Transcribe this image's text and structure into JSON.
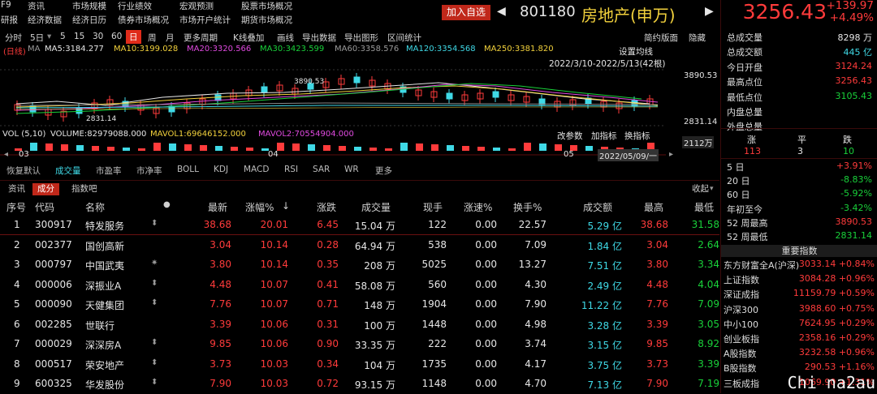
{
  "menu": [
    "F9",
    "资讯",
    "市场规模",
    "行业绩效",
    "宏观预测",
    "股票市场概况",
    "研报",
    "经济数据",
    "经济日历",
    "债券市场概况",
    "市场开户统计",
    "期货市场概况"
  ],
  "add_btn": "加入自选",
  "code": "801180",
  "name": "房地产(申万)",
  "price": "3256.43",
  "change": "+139.97",
  "change_pct": "+4.49%",
  "toolbar": [
    "分时",
    "5日",
    "5",
    "15",
    "30",
    "60",
    "日",
    "周",
    "月",
    "更多周期",
    "K线叠加",
    "画线",
    "导出数据",
    "导出图形",
    "区间统计",
    "简约版面",
    "隐藏"
  ],
  "ma_line": {
    "type": "(日线)",
    "ma": "MA",
    "ma5": "MA5:3184.277",
    "ma10": "MA10:3199.028",
    "ma20": "MA20:3320.566",
    "ma30": "MA30:3423.599",
    "ma60": "MA60:3358.576",
    "ma120": "MA120:3354.568",
    "ma250": "MA250:3381.820"
  },
  "chart": {
    "settings": "设置均线",
    "range": "2022/3/10-2022/5/13(42根)",
    "high_label": "3890.53",
    "low_label": "2831.14",
    "mid_label": "3890.53",
    "cur_label": "3890.53",
    "axis_hi": "3890.53",
    "axis_lo": "2831.14"
  },
  "vol": {
    "label": "VOL (5,10)",
    "volume": "VOLUME:82979088.000",
    "mavol1": "MAVOL1:69646152.000",
    "mavol2": "MAVOL2:70554904.000",
    "params": "改参数",
    "add": "加指标",
    "change": "换指标",
    "axis": "2112万"
  },
  "xaxis": {
    "l1": "03",
    "l2": "04",
    "l3": "05",
    "date": "2022/05/09/一"
  },
  "subtabs": [
    "恢复默认",
    "成交量",
    "市盈率",
    "市净率",
    "BOLL",
    "KDJ",
    "MACD",
    "RSI",
    "SAR",
    "WR",
    "更多"
  ],
  "tabs2": [
    "资讯",
    "成分",
    "指数吧",
    "收起"
  ],
  "headers": {
    "seq": "序号",
    "code": "代码",
    "name": "名称",
    "dot": "●",
    "price": "最新",
    "pct": "涨幅%",
    "chg": "涨跌",
    "vol": "成交量",
    "cur": "现手",
    "speed": "涨速%",
    "turn": "换手%",
    "amt": "成交额",
    "high": "最高",
    "low": "最低",
    "sort": "↓"
  },
  "rows": [
    {
      "i": "1",
      "code": "300917",
      "name": "特发服务",
      "mark": "⬍",
      "price": "38.68",
      "pct": "20.01",
      "chg": "6.45",
      "vol": "15.04 万",
      "cur": "122",
      "speed": "0.00",
      "turn": "22.57",
      "amt": "5.29 亿",
      "high": "38.68",
      "low": "31.58"
    },
    {
      "i": "2",
      "code": "002377",
      "name": "国创高新",
      "mark": "",
      "price": "3.04",
      "pct": "10.14",
      "chg": "0.28",
      "vol": "64.94 万",
      "cur": "538",
      "speed": "0.00",
      "turn": "7.09",
      "amt": "1.84 亿",
      "high": "3.04",
      "low": "2.64"
    },
    {
      "i": "3",
      "code": "000797",
      "name": "中国武夷",
      "mark": "✷",
      "price": "3.80",
      "pct": "10.14",
      "chg": "0.35",
      "vol": "208 万",
      "cur": "5025",
      "speed": "0.00",
      "turn": "13.27",
      "amt": "7.51 亿",
      "high": "3.80",
      "low": "3.34"
    },
    {
      "i": "4",
      "code": "000006",
      "name": "深振业A",
      "mark": "⬍",
      "price": "4.48",
      "pct": "10.07",
      "chg": "0.41",
      "vol": "58.08 万",
      "cur": "560",
      "speed": "0.00",
      "turn": "4.30",
      "amt": "2.49 亿",
      "high": "4.48",
      "low": "4.04"
    },
    {
      "i": "5",
      "code": "000090",
      "name": "天健集团",
      "mark": "⬍",
      "price": "7.76",
      "pct": "10.07",
      "chg": "0.71",
      "vol": "148 万",
      "cur": "1904",
      "speed": "0.00",
      "turn": "7.90",
      "amt": "11.22 亿",
      "high": "7.76",
      "low": "7.09"
    },
    {
      "i": "6",
      "code": "002285",
      "name": "世联行",
      "mark": "",
      "price": "3.39",
      "pct": "10.06",
      "chg": "0.31",
      "vol": "100 万",
      "cur": "1448",
      "speed": "0.00",
      "turn": "4.98",
      "amt": "3.28 亿",
      "high": "3.39",
      "low": "3.05"
    },
    {
      "i": "7",
      "code": "000029",
      "name": "深深房A",
      "mark": "⬍",
      "price": "9.85",
      "pct": "10.06",
      "chg": "0.90",
      "vol": "33.35 万",
      "cur": "222",
      "speed": "0.00",
      "turn": "3.74",
      "amt": "3.15 亿",
      "high": "9.85",
      "low": "8.92"
    },
    {
      "i": "8",
      "code": "000517",
      "name": "荣安地产",
      "mark": "⬍",
      "price": "3.73",
      "pct": "10.03",
      "chg": "0.34",
      "vol": "104 万",
      "cur": "1735",
      "speed": "0.00",
      "turn": "4.17",
      "amt": "3.75 亿",
      "high": "3.73",
      "low": "3.39"
    },
    {
      "i": "9",
      "code": "600325",
      "name": "华发股份",
      "mark": "⬍",
      "price": "7.90",
      "pct": "10.03",
      "chg": "0.72",
      "vol": "93.15 万",
      "cur": "1148",
      "speed": "0.00",
      "turn": "4.70",
      "amt": "7.13 亿",
      "high": "7.90",
      "low": "7.19"
    }
  ],
  "right": {
    "stats": [
      {
        "k": "总成交量",
        "v": "8298 万",
        "c": "white"
      },
      {
        "k": "总成交额",
        "v": "445 亿",
        "c": "cyan"
      },
      {
        "k": "今日开盘",
        "v": "3124.24",
        "c": "red"
      },
      {
        "k": "最高点位",
        "v": "3256.43",
        "c": "red"
      },
      {
        "k": "最低点位",
        "v": "3105.43",
        "c": "green"
      },
      {
        "k": "内盘总量",
        "v": "",
        "c": "white"
      },
      {
        "k": "外盘总量",
        "v": "",
        "c": "white"
      }
    ],
    "updown_labels": [
      "涨",
      "平",
      "跌"
    ],
    "updown_vals": [
      "113",
      "3",
      "10"
    ],
    "periods": [
      {
        "k": "5 日",
        "v": "+3.91%",
        "c": "red"
      },
      {
        "k": "20 日",
        "v": "-8.83%",
        "c": "green"
      },
      {
        "k": "60 日",
        "v": "-5.92%",
        "c": "green"
      },
      {
        "k": "年初至今",
        "v": "-3.42%",
        "c": "green"
      },
      {
        "k": "52 周最高",
        "v": "3890.53",
        "c": "red"
      },
      {
        "k": "52 周最低",
        "v": "2831.14",
        "c": "green"
      }
    ],
    "idx_title": "重要指数",
    "indices": [
      {
        "k": "东方财富全A(沪深)",
        "v": "3033.14 +0.84%"
      },
      {
        "k": "上证指数",
        "v": "3084.28 +0.96%"
      },
      {
        "k": "深证成指",
        "v": "11159.79 +0.59%"
      },
      {
        "k": "沪深300",
        "v": "3988.60 +0.75%"
      },
      {
        "k": "中小100",
        "v": "7624.95 +0.29%"
      },
      {
        "k": "创业板指",
        "v": "2358.16 +0.29%"
      },
      {
        "k": "A股指数",
        "v": "3232.58 +0.96%"
      },
      {
        "k": "B股指数",
        "v": "290.53 +1.16%"
      },
      {
        "k": "三板成指",
        "v": "1069.90 +1.31%"
      }
    ]
  },
  "watermark": "Chi na2au"
}
